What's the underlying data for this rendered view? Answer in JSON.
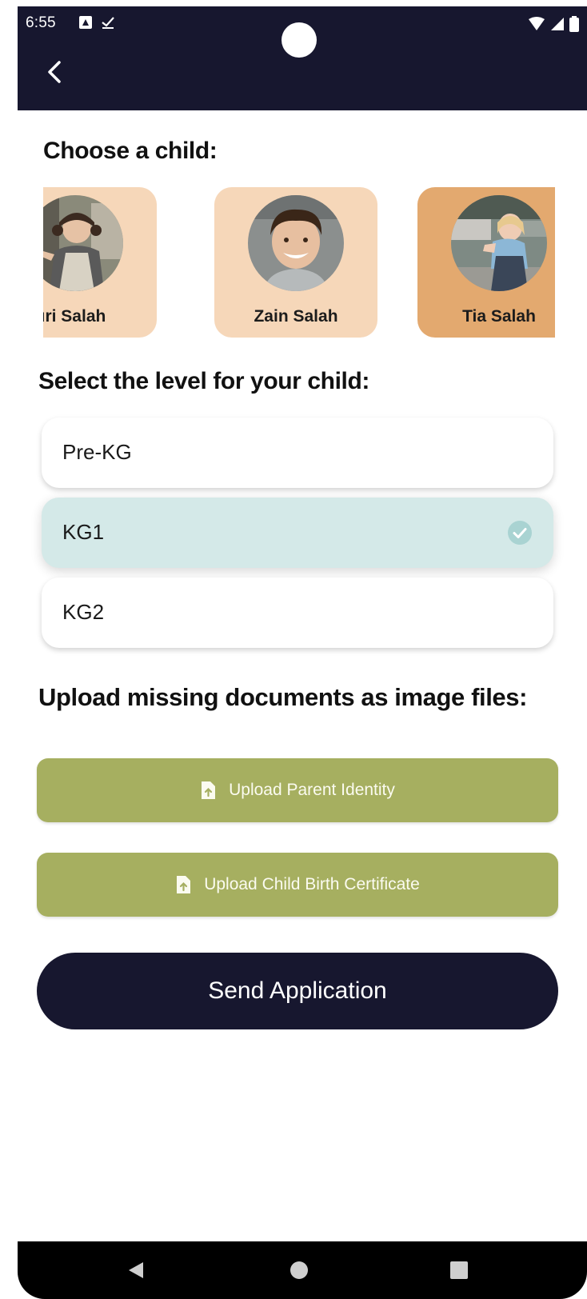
{
  "status_bar": {
    "time": "6:55"
  },
  "header": {
    "back_icon": "chevron-left-icon"
  },
  "choose_child": {
    "title": "Choose a child:",
    "children": [
      {
        "name": "Nouri Salah",
        "selected": false
      },
      {
        "name": "Zain Salah",
        "selected": false
      },
      {
        "name": "Tia Salah",
        "selected": true
      }
    ]
  },
  "levels": {
    "title": "Select the level for your child:",
    "items": [
      {
        "label": "Pre-KG",
        "selected": false
      },
      {
        "label": "KG1",
        "selected": true
      },
      {
        "label": "KG2",
        "selected": false
      }
    ]
  },
  "documents": {
    "title": "Upload missing documents as image files:",
    "buttons": [
      {
        "label": "Upload Parent Identity",
        "icon": "file-upload-icon"
      },
      {
        "label": "Upload Child Birth Certificate",
        "icon": "file-upload-icon"
      }
    ]
  },
  "send_button": {
    "label": "Send Application"
  },
  "colors": {
    "header_bg": "#17172f",
    "card_bg": "#f6d7b9",
    "card_selected_bg": "#e3a96f",
    "level_selected_bg": "#d4e9e8",
    "upload_bg": "#a6af60"
  }
}
